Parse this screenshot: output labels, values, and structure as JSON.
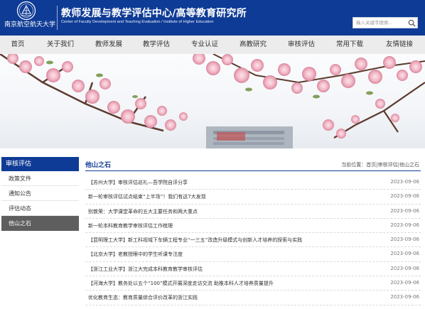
{
  "header": {
    "logo_text": "南京航空航天大学",
    "title": "教师发展与教学评估中心/高等教育研究所",
    "subtitle": "Center of Faculty Development and Teaching Evaluation / Institute of Higher Education",
    "search_placeholder": "输入关键字搜索..."
  },
  "nav": {
    "items": [
      "首页",
      "关于我们",
      "教师发展",
      "教学评估",
      "专业认证",
      "高教研究",
      "审核评估",
      "常用下载",
      "友情链接"
    ]
  },
  "sidebar": {
    "heading": "审核评估",
    "items": [
      "政策文件",
      "通知公告",
      "评估动态",
      "他山之石"
    ],
    "active_index": 3
  },
  "main": {
    "title": "他山之石",
    "breadcrumb_prefix": "当前位置：",
    "breadcrumb": [
      "首页",
      "审核评估",
      "他山之石"
    ],
    "breadcrumb_sep": "|",
    "articles": [
      {
        "title": "【苏州大学】审核评估巡礼—吾学院自评分享",
        "date": "2023-09-06"
      },
      {
        "title": "新一轮审核评估试点结束“上半场”！我们有这7大发现",
        "date": "2023-09-06"
      },
      {
        "title": "别敦荣：大学课堂革命的五大主要任务和两大重点",
        "date": "2023-09-06"
      },
      {
        "title": "新一轮本科教育教学审核评估工作梳理",
        "date": "2023-09-06"
      },
      {
        "title": "【昆明理工大学】新工科视域下车辆工程专业“一三五”改造升级模式与创新人才培养的探索与实践",
        "date": "2023-09-06"
      },
      {
        "title": "【北京大学】老教授眼中的学生听课专注度",
        "date": "2023-09-06"
      },
      {
        "title": "【浙江工业大学】浙江大完成本科教育教学审核评估",
        "date": "2023-09-06"
      },
      {
        "title": "【河海大学】教务处以五个“100”模式开展深度走访交流 助推本科人才培养质量提升",
        "date": "2023-09-06"
      },
      {
        "title": "优化教育生态：教育质量综合评价改革的浙江实践",
        "date": "2023-09-06"
      }
    ]
  },
  "colors": {
    "brand": "#0e3b95",
    "nav_bg": "#ececec",
    "sidebar_active": "#5e5e5e"
  },
  "icons": {
    "search": "search-icon",
    "logo": "university-emblem-icon"
  }
}
